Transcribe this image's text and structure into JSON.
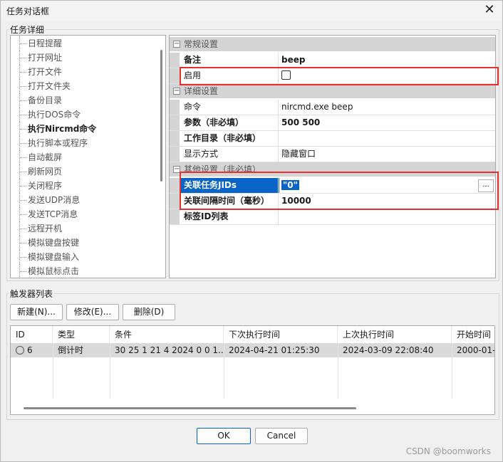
{
  "window": {
    "title": "任务对话框",
    "close_glyph": "✕"
  },
  "task_group": {
    "legend": "任务详细"
  },
  "tree_items": [
    "日程提醒",
    "打开网址",
    "打开文件",
    "打开文件夹",
    "备份目录",
    "执行DOS命令",
    "执行Nircmd命令",
    "执行脚本或程序",
    "自动截屏",
    "刷新网页",
    "关闭程序",
    "发送UDP消息",
    "发送TCP消息",
    "远程开机",
    "模拟键盘按键",
    "模拟键盘输入",
    "模拟鼠标点击"
  ],
  "tree_selected": "执行Nircmd命令",
  "props": {
    "cat_general": "常规设置",
    "remark_label": "备注",
    "remark_value": "beep",
    "enabled_label": "启用",
    "cat_detail": "详细设置",
    "command_label": "命令",
    "command_value": "nircmd.exe beep",
    "params_label": "参数（非必填）",
    "params_value": "500 500",
    "workdir_label": "工作目录（非必填）",
    "workdir_value": "",
    "display_label": "显示方式",
    "display_value": "隐藏窗口",
    "cat_other": "其他设置（非必填）",
    "jid_label": "关联任务JIDs",
    "jid_value": "\"0\"",
    "jid_button": "...",
    "interval_label": "关联间隔时间（毫秒）",
    "interval_value": "10000",
    "tagid_label": "标签ID列表",
    "tagid_value": ""
  },
  "trigger_group": {
    "legend": "触发器列表"
  },
  "trigger_buttons": {
    "new": "新建(N)...",
    "edit": "修改(E)...",
    "delete": "删除(D)"
  },
  "list_headers": [
    "ID",
    "类型",
    "条件",
    "下次执行时间",
    "上次执行时间",
    "开始时间"
  ],
  "list_rows": [
    {
      "id": "6",
      "type": "倒计时",
      "cond": "30 25 1 21 4 2024 0 0 1...",
      "next": "2024-04-21 01:25:30",
      "last": "2024-03-09 22:08:40",
      "start": "2000-01-"
    }
  ],
  "footer": {
    "ok": "OK",
    "cancel": "Cancel"
  },
  "watermark": "CSDN @boomworks",
  "colors": {
    "selection": "#0a64c8",
    "highlight_box": "#e53030"
  }
}
